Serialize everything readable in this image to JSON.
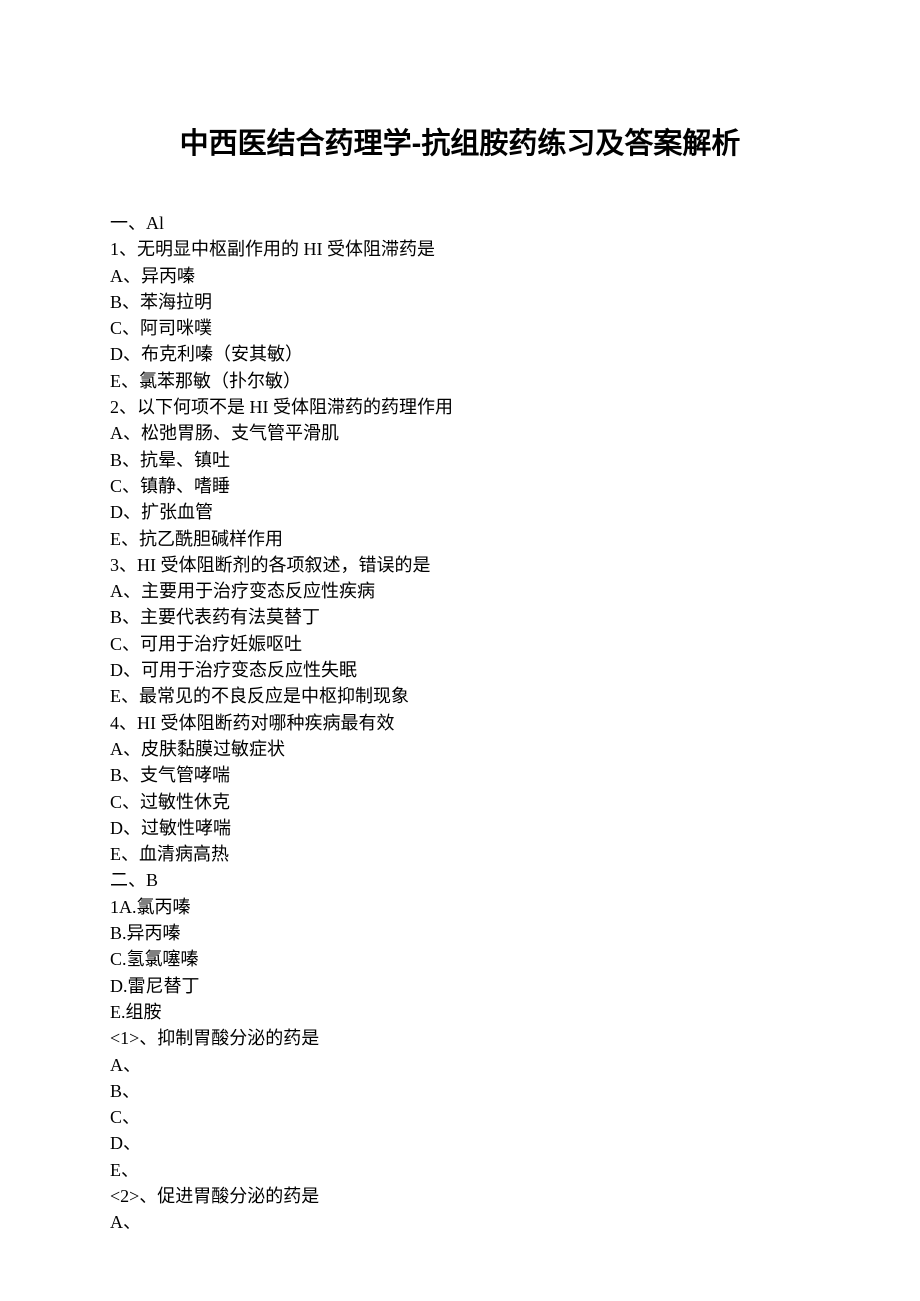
{
  "title": "中西医结合药理学-抗组胺药练习及答案解析",
  "sections": [
    {
      "heading": "一、Al",
      "questions": [
        {
          "stem": "1、无明显中枢副作用的 HI 受体阻滞药是",
          "options": [
            "A、异丙嗪",
            "B、苯海拉明",
            "C、阿司咪噗",
            "D、布克利嗪（安其敏）",
            "E、氯苯那敏（扑尔敏）"
          ]
        },
        {
          "stem": "2、以下何项不是 HI 受体阻滞药的药理作用",
          "options": [
            "A、松弛胃肠、支气管平滑肌",
            "B、抗晕、镇吐",
            "C、镇静、嗜睡",
            "D、扩张血管",
            "E、抗乙酰胆碱样作用"
          ]
        },
        {
          "stem": "3、HI 受体阻断剂的各项叙述，错误的是",
          "options": [
            "A、主要用于治疗变态反应性疾病",
            "B、主要代表药有法莫替丁",
            "C、可用于治疗妊娠呕吐",
            "D、可用于治疗变态反应性失眠",
            "E、最常见的不良反应是中枢抑制现象"
          ]
        },
        {
          "stem": "4、HI 受体阻断药对哪种疾病最有效",
          "options": [
            "A、皮肤黏膜过敏症状",
            "B、支气管哮喘",
            "C、过敏性休克",
            "D、过敏性哮喘",
            "E、血清病高热"
          ]
        }
      ]
    },
    {
      "heading": "二、B",
      "shared_options": [
        "1A.氯丙嗪",
        "B.异丙嗪",
        "C.氢氯噻嗪",
        "D.雷尼替丁",
        "E.组胺"
      ],
      "subquestions": [
        {
          "stem": "<1>、抑制胃酸分泌的药是",
          "options": [
            "A、",
            "B、",
            "C、",
            "D、",
            "E、"
          ]
        },
        {
          "stem": "<2>、促进胃酸分泌的药是",
          "options": [
            "A、"
          ]
        }
      ]
    }
  ]
}
